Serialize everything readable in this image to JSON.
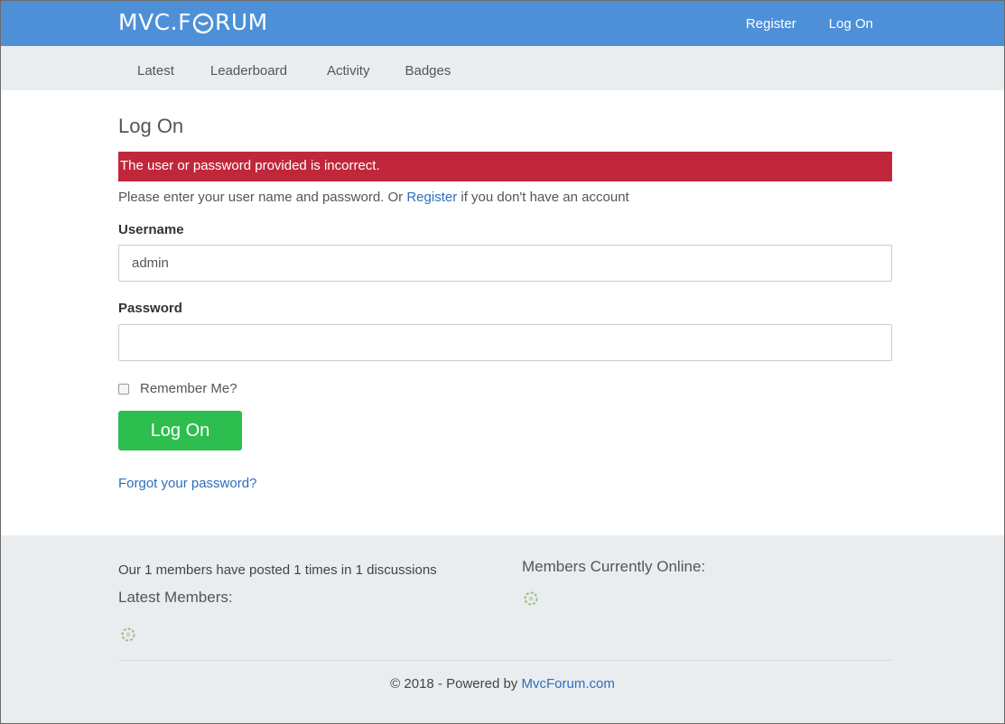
{
  "header": {
    "logo_left": "MVC.F",
    "logo_right": "RUM",
    "register_label": "Register",
    "logon_label": "Log On"
  },
  "subnav": {
    "items": [
      "Latest",
      "Leaderboard",
      "Activity",
      "Badges"
    ]
  },
  "main": {
    "title": "Log On",
    "error": "The user or password provided is incorrect.",
    "intro_prefix": "Please enter your user name and password. Or ",
    "intro_link": "Register",
    "intro_suffix": " if you don't have an account",
    "username_label": "Username",
    "username_value": "admin",
    "password_label": "Password",
    "password_value": "",
    "remember_label": "Remember Me?",
    "remember_checked": false,
    "submit_label": "Log On",
    "forgot_label": "Forgot your password?"
  },
  "footer": {
    "stats": "Our 1 members have posted 1 times in 1 discussions",
    "latest_members": "Latest Members:",
    "online": "Members Currently Online:",
    "copyright_prefix": "© 2018 - Powered by ",
    "copyright_link": "MvcForum.com"
  },
  "colors": {
    "topbar": "#4d90d8",
    "subnav": "#e9edf0",
    "error": "#c0273a",
    "button": "#2dbe4f",
    "link": "#2c6ebd"
  }
}
